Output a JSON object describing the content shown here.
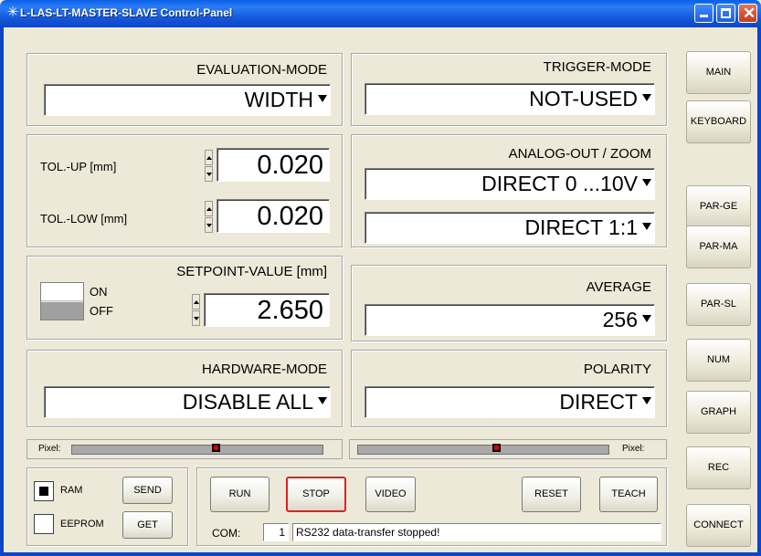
{
  "window": {
    "title": "L-LAS-LT-MASTER-SLAVE  Control-Panel"
  },
  "evaluation": {
    "label": "EVALUATION-MODE",
    "value": "WIDTH"
  },
  "trigger": {
    "label": "TRIGGER-MODE",
    "value": "NOT-USED"
  },
  "tol_up": {
    "label": "TOL.-UP  [mm]",
    "value": "0.020"
  },
  "tol_low": {
    "label": "TOL.-LOW [mm]",
    "value": "0.020"
  },
  "analog": {
    "label": "ANALOG-OUT / ZOOM",
    "value": "DIRECT 0 ...10V",
    "zoom": "DIRECT 1:1"
  },
  "setpoint": {
    "label": "SETPOINT-VALUE [mm]",
    "on": "ON",
    "off": "OFF",
    "value": "2.650"
  },
  "average": {
    "label": "AVERAGE",
    "value": "256"
  },
  "hardware": {
    "label": "HARDWARE-MODE",
    "value": "DISABLE ALL"
  },
  "polarity": {
    "label": "POLARITY",
    "value": "DIRECT"
  },
  "pixel": {
    "left_label": "Pixel:",
    "right_label": "Pixel:",
    "left_position": 0.58,
    "right_position": 0.56
  },
  "memory": {
    "ram": "RAM",
    "eeprom": "EEPROM",
    "send": "SEND",
    "get": "GET"
  },
  "controls": {
    "run": "RUN",
    "stop": "STOP",
    "video": "VIDEO",
    "reset": "RESET",
    "teach": "TEACH"
  },
  "com": {
    "label": "COM:",
    "port": "1",
    "status": "RS232 data-transfer stopped!"
  },
  "sidebar": {
    "main": "MAIN",
    "keyboard": "KEYBOARD",
    "par_ge": "PAR-GE",
    "par_ma": "PAR-MA",
    "par_sl": "PAR-SL",
    "num": "NUM",
    "graph": "GRAPH",
    "rec": "REC",
    "connect": "CONNECT"
  }
}
